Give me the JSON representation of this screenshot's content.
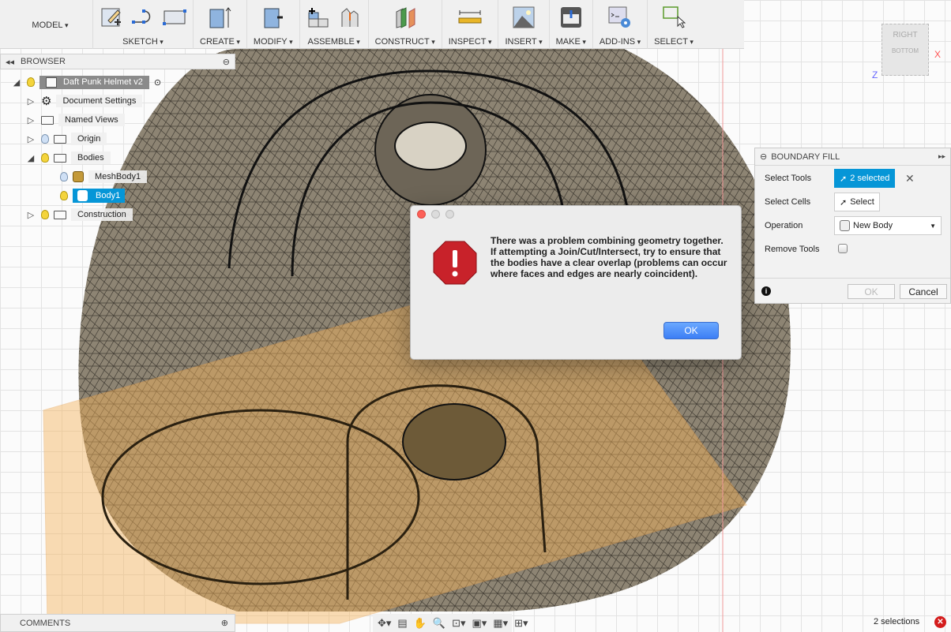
{
  "toolbar": {
    "workspace": "MODEL",
    "groups": [
      {
        "label": "SKETCH",
        "icons": [
          "sketch-create-icon",
          "spline-icon",
          "rectangle-icon"
        ]
      },
      {
        "label": "CREATE",
        "icons": [
          "extrude-icon"
        ]
      },
      {
        "label": "MODIFY",
        "icons": [
          "press-pull-icon"
        ]
      },
      {
        "label": "ASSEMBLE",
        "icons": [
          "new-component-icon",
          "joint-icon"
        ]
      },
      {
        "label": "CONSTRUCT",
        "icons": [
          "offset-plane-icon"
        ]
      },
      {
        "label": "INSPECT",
        "icons": [
          "measure-icon"
        ]
      },
      {
        "label": "INSERT",
        "icons": [
          "insert-image-icon"
        ]
      },
      {
        "label": "MAKE",
        "icons": [
          "3d-print-icon"
        ]
      },
      {
        "label": "ADD-INS",
        "icons": [
          "scripts-icon"
        ]
      },
      {
        "label": "SELECT",
        "icons": [
          "select-window-icon"
        ]
      }
    ]
  },
  "browser": {
    "title": "BROWSER",
    "root": "Daft Punk Helmet v2",
    "items": [
      "Document Settings",
      "Named Views",
      "Origin",
      "Bodies",
      "MeshBody1",
      "Body1",
      "Construction"
    ]
  },
  "viewcube": {
    "face_top": "RIGHT",
    "face_side": "BOTTOM",
    "axis_x": "X",
    "axis_z": "Z"
  },
  "dialog": {
    "message": "There was a problem combining geometry together.\n    If attempting a Join/Cut/Intersect, try to ensure that the bodies have a clear overlap (problems can occur where faces and edges are nearly coincident).",
    "ok": "OK",
    "icon": "stop-error-icon"
  },
  "boundary_fill": {
    "title": "BOUNDARY FILL",
    "select_tools_label": "Select Tools",
    "select_tools_value": "2 selected",
    "select_cells_label": "Select Cells",
    "select_cells_value": "Select",
    "operation_label": "Operation",
    "operation_value": "New Body",
    "remove_tools_label": "Remove Tools",
    "remove_tools_checked": false,
    "ok": "OK",
    "cancel": "Cancel"
  },
  "comments": {
    "title": "COMMENTS"
  },
  "status": {
    "selections": "2 selections"
  },
  "colors": {
    "accent": "#0696d7",
    "mesh": "#8c8272",
    "plane": "#f5c27a",
    "error": "#d41c1c"
  }
}
